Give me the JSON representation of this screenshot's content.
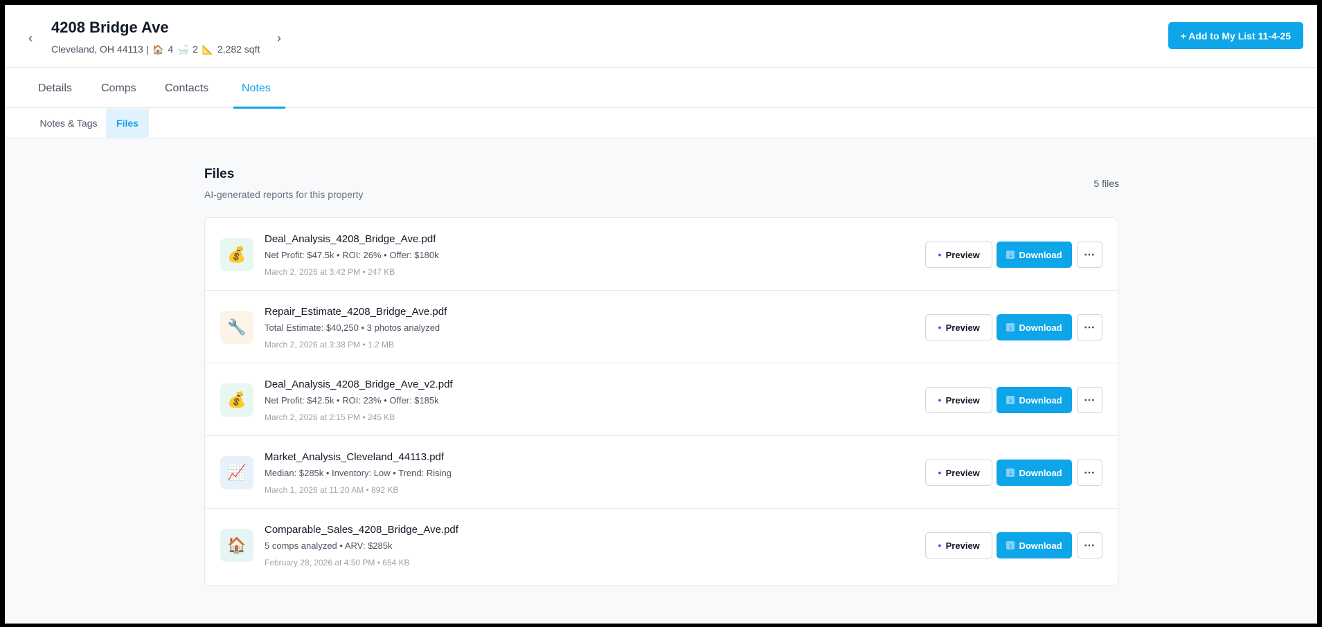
{
  "property": {
    "title": "4208 Bridge Ave",
    "location": "Cleveland, OH 44113 |",
    "beds": "4",
    "baths": "2",
    "sqft": "2,282 sqft",
    "add_button": "+ Add to My List 11-4-25"
  },
  "main_tabs": [
    {
      "label": "Details"
    },
    {
      "label": "Comps"
    },
    {
      "label": "Contacts"
    },
    {
      "label": "Notes"
    }
  ],
  "sub_tabs": [
    {
      "label": "Notes & Tags"
    },
    {
      "label": "Files"
    }
  ],
  "files": {
    "title": "Files",
    "subtitle": "AI-generated reports for this property",
    "count": "5 files",
    "preview_label": "Preview",
    "download_label": "Download",
    "items": [
      {
        "name": "Deal_Analysis_4208_Bridge_Ave.pdf",
        "summary": "Net Profit: $47.5k • ROI: 26% • Offer: $180k",
        "date": "March 2, 2026 at 3:42 PM • 247 KB",
        "icon": "money-bag-icon",
        "icon_bg": "#e8f7ef",
        "glyph": "💰"
      },
      {
        "name": "Repair_Estimate_4208_Bridge_Ave.pdf",
        "summary": "Total Estimate: $40,250 • 3 photos analyzed",
        "date": "March 2, 2026 at 3:38 PM • 1.2 MB",
        "icon": "wrench-icon",
        "icon_bg": "#fdf3e6",
        "glyph": "🔧"
      },
      {
        "name": "Deal_Analysis_4208_Bridge_Ave_v2.pdf",
        "summary": "Net Profit: $42.5k • ROI: 23% • Offer: $185k",
        "date": "March 2, 2026 at 2:15 PM • 245 KB",
        "icon": "money-bag-icon",
        "icon_bg": "#e8f7ef",
        "glyph": "💰"
      },
      {
        "name": "Market_Analysis_Cleveland_44113.pdf",
        "summary": "Median: $285k • Inventory: Low • Trend: Rising",
        "date": "March 1, 2026 at 11:20 AM • 892 KB",
        "icon": "chart-up-icon",
        "icon_bg": "#e6f1fb",
        "glyph": "📈"
      },
      {
        "name": "Comparable_Sales_4208_Bridge_Ave.pdf",
        "summary": "5 comps analyzed • ARV: $285k",
        "date": "February 28, 2026 at 4:50 PM • 654 KB",
        "icon": "house-icon",
        "icon_bg": "#e6f4f4",
        "glyph": "🏠"
      }
    ]
  },
  "colors": {
    "accent": "#0ea5e9"
  }
}
